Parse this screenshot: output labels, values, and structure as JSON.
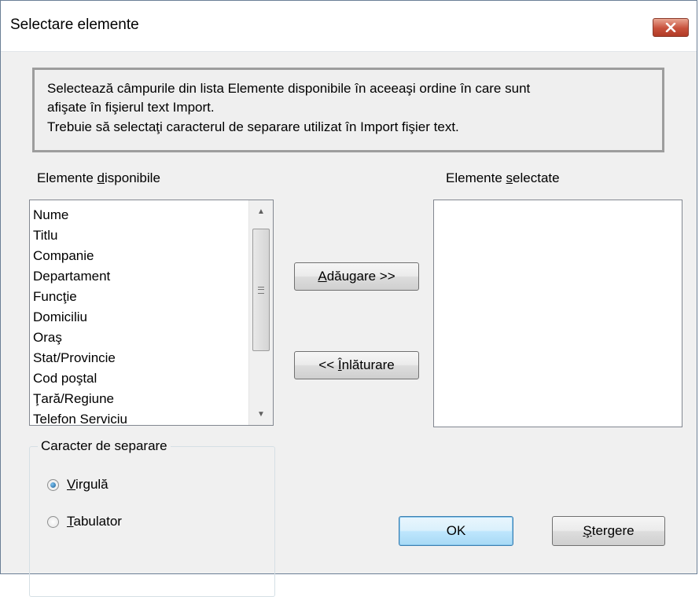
{
  "window": {
    "title": "Selectare elemente",
    "close_icon": "close-icon"
  },
  "info": {
    "line1": "Selectează câmpurile din lista Elemente disponibile în aceeaşi ordine în care sunt",
    "line2": "afişate în fişierul text Import.",
    "line3": "Trebuie să selectaţi caracterul de separare utilizat în Import fişier text."
  },
  "available": {
    "label_pre": "Elemente ",
    "label_ul": "d",
    "label_post": "isponibile",
    "items": [
      "Nume",
      "Titlu",
      "Companie",
      "Departament",
      "Funcţie",
      "Domiciliu",
      "Oraş",
      "Stat/Provincie",
      "Cod poştal",
      "Ţară/Regiune",
      "Telefon Serviciu"
    ]
  },
  "selected": {
    "label_pre": "Elemente ",
    "label_ul": "s",
    "label_post": "electate",
    "items": []
  },
  "buttons": {
    "add_ul": "A",
    "add_rest": "dăugare >>",
    "remove_pre": "<< ",
    "remove_ul": "Î",
    "remove_rest": "nlăturare",
    "ok": "OK",
    "delete_ul": "Ş",
    "delete_rest": "tergere"
  },
  "separator": {
    "title": "Caracter de separare",
    "options": [
      {
        "ul": "V",
        "rest": "irgulă",
        "checked": true
      },
      {
        "ul": "T",
        "rest": "abulator",
        "checked": false
      }
    ]
  }
}
